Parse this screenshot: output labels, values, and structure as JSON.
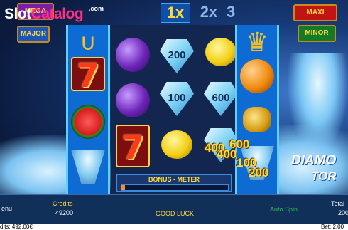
{
  "watermark": {
    "brand_a": "Slot",
    "brand_b": "Catalog",
    "suffix": ".com"
  },
  "jackpots": {
    "mega": "MEGA",
    "major": "MAJOR",
    "maxi": "MAXI",
    "minor": "MINOR"
  },
  "multipliers": [
    "1x",
    "2x",
    "3"
  ],
  "reels": [
    [
      "horseshoe",
      "seven",
      "watermelon",
      "tornado"
    ],
    [
      "plum",
      "plum",
      "seven"
    ],
    [
      "diamond",
      "diamond",
      "lemon"
    ],
    [
      "lemon",
      "diamond",
      "diamond"
    ],
    [
      "crown",
      "orange",
      "coins",
      "tornado"
    ]
  ],
  "diamond_values": [
    "200",
    "100",
    "600"
  ],
  "wins": [
    "600",
    "400",
    "400",
    "100",
    "200"
  ],
  "bonus_meter": {
    "label": "BONUS - METER",
    "fill": 0.03
  },
  "game_logo_fragments": [
    "DIAMO",
    "TOR"
  ],
  "bottom_bar": {
    "menu": "enu",
    "credits_label": "Credits",
    "credits_value": "49200",
    "message": "GOOD LUCK",
    "autospin": "Auto Spin",
    "total_label": "Total",
    "total_value": "200"
  },
  "status_bar": {
    "credits": "dits: 492.00€",
    "bet": "Bet: 2.00"
  },
  "colors": {
    "accent": "#ffd83a",
    "frame": "#0e6bd3",
    "logo_pink": "#ff2e86"
  }
}
